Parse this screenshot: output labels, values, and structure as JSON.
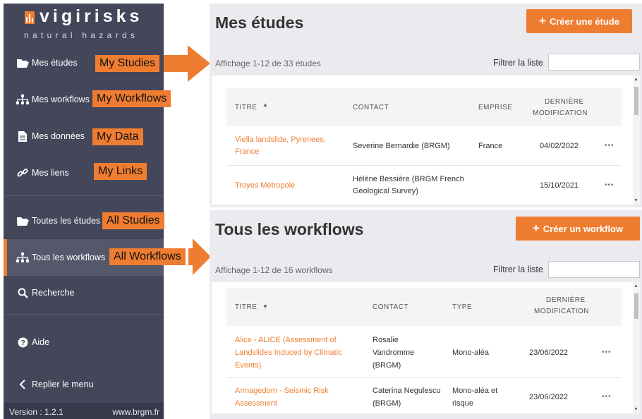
{
  "sidebar": {
    "logo_word": "vigirisks",
    "logo_sub": "natural hazards",
    "items": [
      {
        "label": "Mes études",
        "annotation": "My Studies"
      },
      {
        "label": "Mes workflows",
        "annotation": "My Workflows"
      },
      {
        "label": "Mes données",
        "annotation": "My Data"
      },
      {
        "label": "Mes liens",
        "annotation": "My Links"
      },
      {
        "label": "Toutes les études",
        "annotation": "All Studies"
      },
      {
        "label": "Tous les workflows",
        "annotation": "All Workflows"
      },
      {
        "label": "Recherche"
      },
      {
        "label": "Aide"
      },
      {
        "label": "Replier le menu"
      }
    ],
    "version": "Version : 1.2.1",
    "site": "www.brgm.fr"
  },
  "studies": {
    "title": "Mes études",
    "create_label": "Créer une étude",
    "count": "Affichage 1-12 de 33 études",
    "filter_label": "Filtrer la liste",
    "columns": {
      "title": "TITRE",
      "sort_icon": "▲",
      "contact": "CONTACT",
      "emprise": "EMPRISE",
      "date_1": "DERNIÈRE",
      "date_2": "MODIFICATION"
    },
    "rows": [
      {
        "title_1": "Viella landslide, Pyrenees,",
        "title_2": "France",
        "contact": "Severine Bernardie (BRGM)",
        "emprise": "France",
        "date": "04/02/2022",
        "actions": "•••"
      },
      {
        "title_1": "Troyes Métropole",
        "contact_1": "Hélène Bessière (BRGM French",
        "contact_2": "Geological Survey)",
        "date": "15/10/2021",
        "actions": "•••"
      }
    ]
  },
  "workflows": {
    "title": "Tous les workflows",
    "create_label": "Créer un workflow",
    "count": "Affichage 1-12 de 16 workflows",
    "filter_label": "Filtrer la liste",
    "columns": {
      "title": "TITRE",
      "sort_icon": "▼",
      "contact": "CONTACT",
      "type": "TYPE",
      "date_1": "DERNIÈRE",
      "date_2": "MODIFICATION"
    },
    "rows": [
      {
        "title_1": "Alice - ALICE (Assessment of",
        "title_2": "Landslides Induced by Climatic",
        "title_3": "Events)",
        "contact_1": "Rosalie",
        "contact_2": "Vandromme",
        "contact_3": "(BRGM)",
        "type": "Mono-aléa",
        "date": "23/06/2022",
        "actions": "•••"
      },
      {
        "title_1": "Armagedom - Seismic Risk",
        "title_2": "Assessment",
        "contact_1": "Caterina Negulescu",
        "contact_2": "(BRGM)",
        "type_1": "Mono-aléa et",
        "type_2": "risque",
        "date": "23/06/2022",
        "actions": "•••"
      }
    ]
  },
  "colors": {
    "accent": "#ef7d31",
    "sidebar": "#44465a",
    "panel": "#ebebef"
  }
}
